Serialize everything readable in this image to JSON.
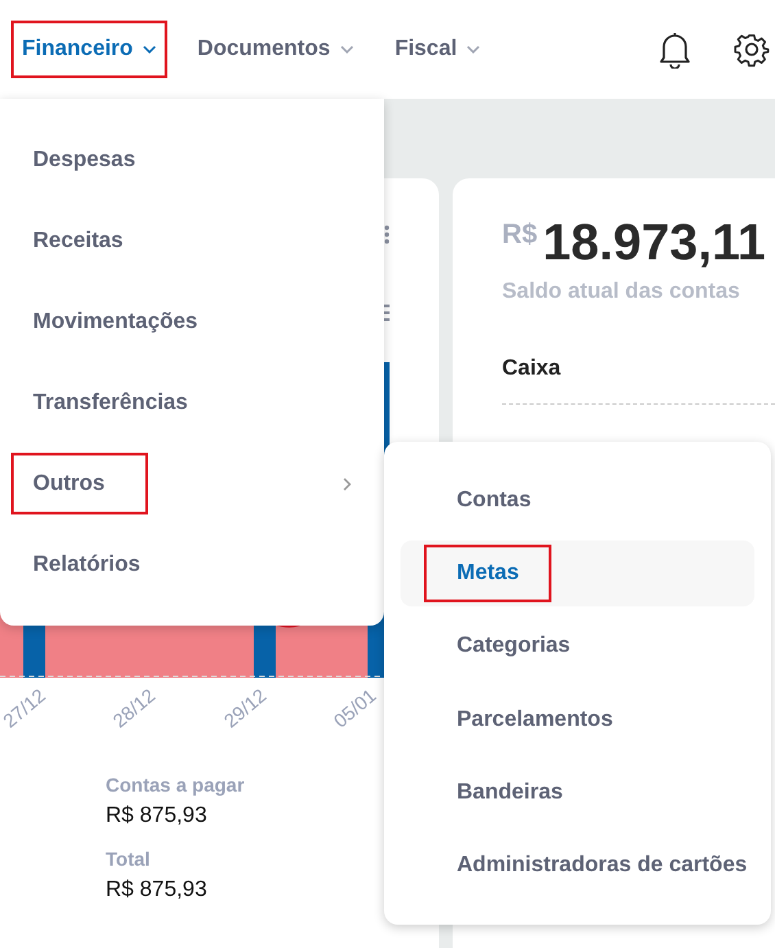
{
  "nav": {
    "items": [
      {
        "label": "Financeiro",
        "selected": true,
        "annotated": true
      },
      {
        "label": "Documentos",
        "selected": false,
        "annotated": false
      },
      {
        "label": "Fiscal",
        "selected": false,
        "annotated": false
      }
    ]
  },
  "menu": {
    "items": [
      {
        "label": "Despesas",
        "kind": "link",
        "annotated": false
      },
      {
        "label": "Receitas",
        "kind": "link",
        "annotated": false
      },
      {
        "label": "Movimentações",
        "kind": "link",
        "annotated": false
      },
      {
        "label": "Transferências",
        "kind": "link",
        "annotated": false
      },
      {
        "label": "Outros",
        "kind": "submenu",
        "annotated": true
      },
      {
        "label": "Relatórios",
        "kind": "link",
        "annotated": false
      }
    ]
  },
  "submenu": {
    "items": [
      {
        "label": "Contas",
        "selected": false,
        "annotated": false
      },
      {
        "label": "Metas",
        "selected": true,
        "annotated": true
      },
      {
        "label": "Categorias",
        "selected": false,
        "annotated": false
      },
      {
        "label": "Parcelamentos",
        "selected": false,
        "annotated": false
      },
      {
        "label": "Bandeiras",
        "selected": false,
        "annotated": false
      },
      {
        "label": "Administradoras de cartões",
        "selected": false,
        "annotated": false
      }
    ]
  },
  "chart_card": {
    "x_labels": [
      "27/12",
      "28/12",
      "29/12",
      "05/01"
    ],
    "stats": [
      {
        "label": "Contas a pagar",
        "value": "R$ 875,93"
      },
      {
        "label": "Total",
        "value": "R$ 875,93"
      }
    ]
  },
  "balance_card": {
    "currency": "R$",
    "amount": "18.973,11",
    "caption": "Saldo atual das contas",
    "accounts": [
      "Caixa"
    ]
  }
}
